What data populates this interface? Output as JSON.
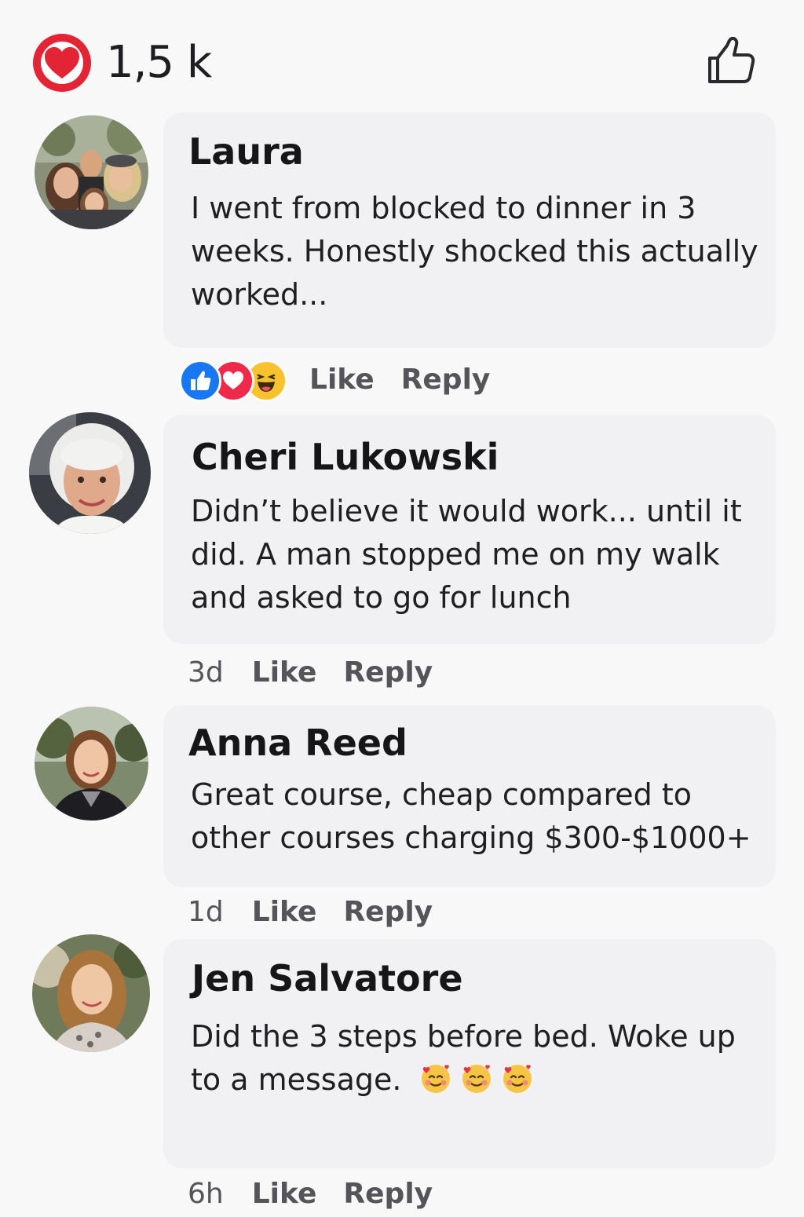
{
  "header": {
    "reaction_icon": "heart-icon",
    "reaction_count": "1,5 k",
    "like_icon": "thumbs-up-icon"
  },
  "comments": [
    {
      "author": "Laura",
      "text": "I went from blocked to dinner in 3 weeks. Honestly shocked this actually worked...",
      "time": "",
      "like_label": "Like",
      "reply_label": "Reply",
      "reactions": [
        "like-icon",
        "love-icon",
        "haha-icon"
      ]
    },
    {
      "author": "Cheri Lukowski",
      "text": "Didn’t believe it would work... until it did. A man stopped me on my walk and asked to go for lunch",
      "time": "3d",
      "like_label": "Like",
      "reply_label": "Reply"
    },
    {
      "author": "Anna Reed",
      "text": "Great course, cheap compared to other courses charging $300-$1000+",
      "time": "1d",
      "like_label": "Like",
      "reply_label": "Reply"
    },
    {
      "author": "Jen Salvatore",
      "text": "Did the 3 steps before bed. Woke up to a message.",
      "emojis": [
        "smiling-face-with-hearts-icon",
        "smiling-face-with-hearts-icon",
        "smiling-face-with-hearts-icon"
      ],
      "time": "6h",
      "like_label": "Like",
      "reply_label": "Reply"
    }
  ],
  "colors": {
    "background": "#f8f8f9",
    "bubble": "#f1f1f3",
    "heart_red": "#e22434",
    "like_blue": "#1877f2",
    "love_red": "#f02849",
    "haha_yellow": "#f7c22e"
  }
}
